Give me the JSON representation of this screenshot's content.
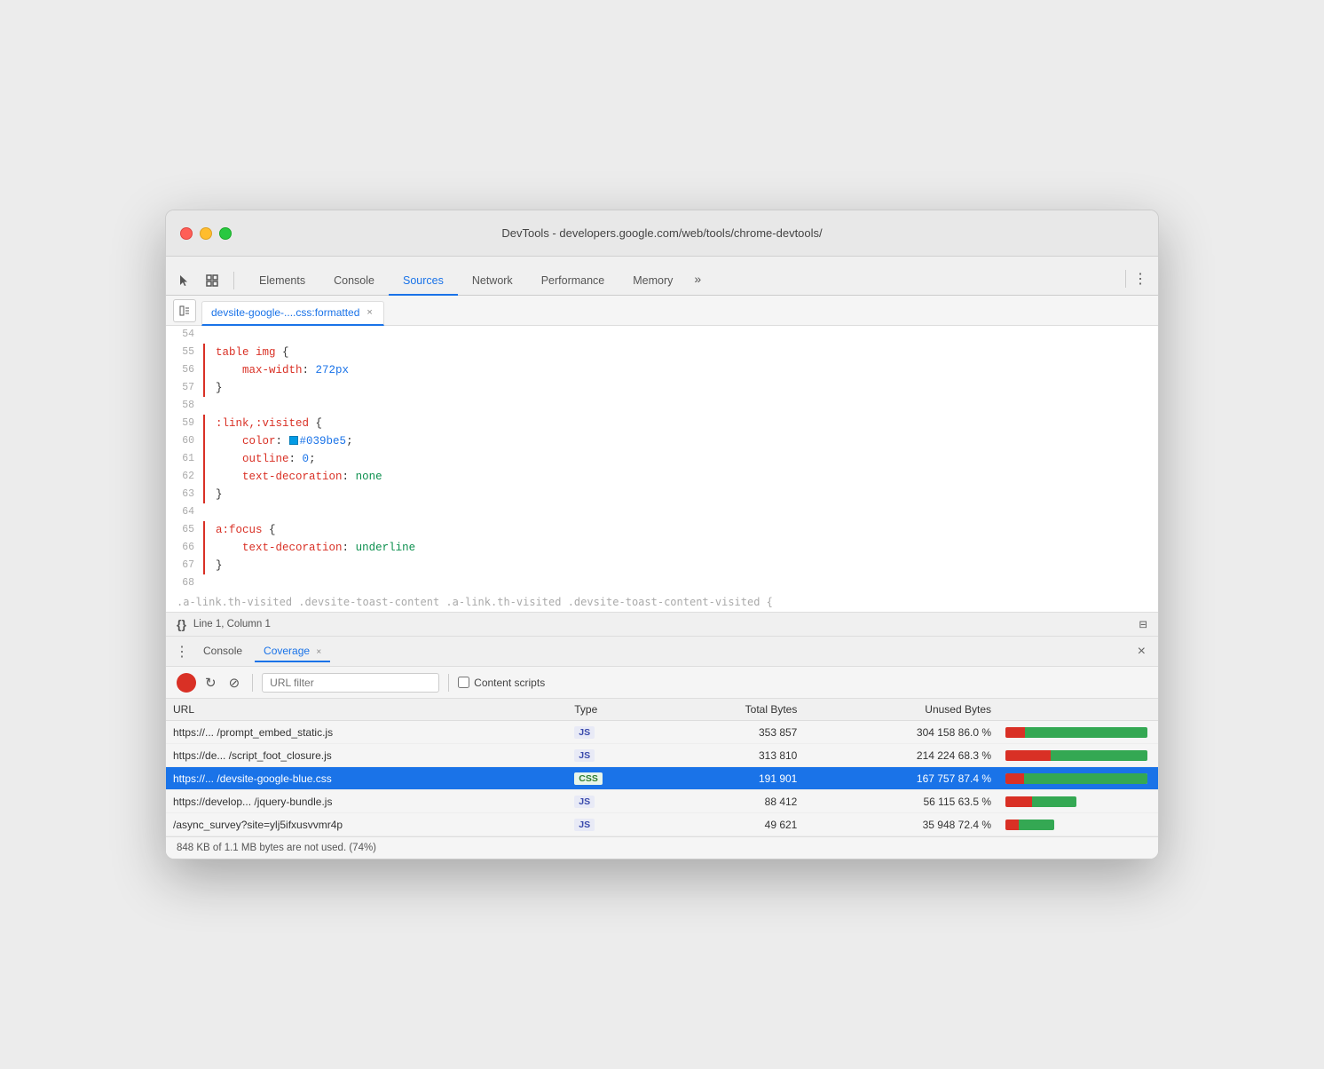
{
  "window": {
    "title": "DevTools - developers.google.com/web/tools/chrome-devtools/"
  },
  "tabs": {
    "items": [
      {
        "label": "Elements",
        "active": false
      },
      {
        "label": "Console",
        "active": false
      },
      {
        "label": "Sources",
        "active": true
      },
      {
        "label": "Network",
        "active": false
      },
      {
        "label": "Performance",
        "active": false
      },
      {
        "label": "Memory",
        "active": false
      }
    ],
    "more_label": "»"
  },
  "filetab": {
    "label": "devsite-google-....css:formatted",
    "close_icon": "×"
  },
  "code": {
    "lines": [
      {
        "num": "54",
        "content": "",
        "bar": false
      },
      {
        "num": "55",
        "content": "table img {",
        "bar": true
      },
      {
        "num": "56",
        "content": "    max-width: 272px",
        "bar": true,
        "has_value": true
      },
      {
        "num": "57",
        "content": "}",
        "bar": true
      },
      {
        "num": "58",
        "content": "",
        "bar": false
      },
      {
        "num": "59",
        "content": ":link,:visited {",
        "bar": true
      },
      {
        "num": "60",
        "content": "    color: ",
        "bar": true,
        "color_swatch": "#039be5",
        "color_text": "#039be5;",
        "has_color": true
      },
      {
        "num": "61",
        "content": "    outline: 0;",
        "bar": true
      },
      {
        "num": "62",
        "content": "    text-decoration: none",
        "bar": true
      },
      {
        "num": "63",
        "content": "}",
        "bar": true
      },
      {
        "num": "64",
        "content": "",
        "bar": false
      },
      {
        "num": "65",
        "content": "a:focus {",
        "bar": true
      },
      {
        "num": "66",
        "content": "    text-decoration: underline",
        "bar": true
      },
      {
        "num": "67",
        "content": "}",
        "bar": true
      },
      {
        "num": "68",
        "content": "",
        "bar": false
      }
    ]
  },
  "statusbar": {
    "braces": "{}",
    "position": "Line 1, Column 1",
    "scroll_icon": "⊟"
  },
  "bottom_panel": {
    "tabs": [
      {
        "label": "Console",
        "active": false,
        "closeable": false
      },
      {
        "label": "Coverage",
        "active": true,
        "closeable": true
      }
    ],
    "close_icon": "×",
    "more_icon": "⋮"
  },
  "coverage": {
    "toolbar": {
      "url_filter_placeholder": "URL filter",
      "content_scripts_label": "Content scripts"
    },
    "table": {
      "headers": [
        "URL",
        "Type",
        "Total Bytes",
        "Unused Bytes",
        ""
      ],
      "rows": [
        {
          "url": "https://... /prompt_embed_static.js",
          "type": "JS",
          "total_bytes": "353 857",
          "unused_bytes": "304 158",
          "unused_pct": "86.0 %",
          "used_ratio": 14,
          "unused_ratio": 86,
          "selected": false
        },
        {
          "url": "https://de... /script_foot_closure.js",
          "type": "JS",
          "total_bytes": "313 810",
          "unused_bytes": "214 224",
          "unused_pct": "68.3 %",
          "used_ratio": 32,
          "unused_ratio": 68,
          "selected": false
        },
        {
          "url": "https://... /devsite-google-blue.css",
          "type": "CSS",
          "total_bytes": "191 901",
          "unused_bytes": "167 757",
          "unused_pct": "87.4 %",
          "used_ratio": 13,
          "unused_ratio": 87,
          "selected": true
        },
        {
          "url": "https://develop... /jquery-bundle.js",
          "type": "JS",
          "total_bytes": "88 412",
          "unused_bytes": "56 115",
          "unused_pct": "63.5 %",
          "used_ratio": 37,
          "unused_ratio": 63,
          "selected": false
        },
        {
          "url": "/async_survey?site=ylj5ifxusvvmr4p",
          "type": "JS",
          "total_bytes": "49 621",
          "unused_bytes": "35 948",
          "unused_pct": "72.4 %",
          "used_ratio": 28,
          "unused_ratio": 72,
          "selected": false
        }
      ]
    },
    "footer": "848 KB of 1.1 MB bytes are not used. (74%)"
  }
}
